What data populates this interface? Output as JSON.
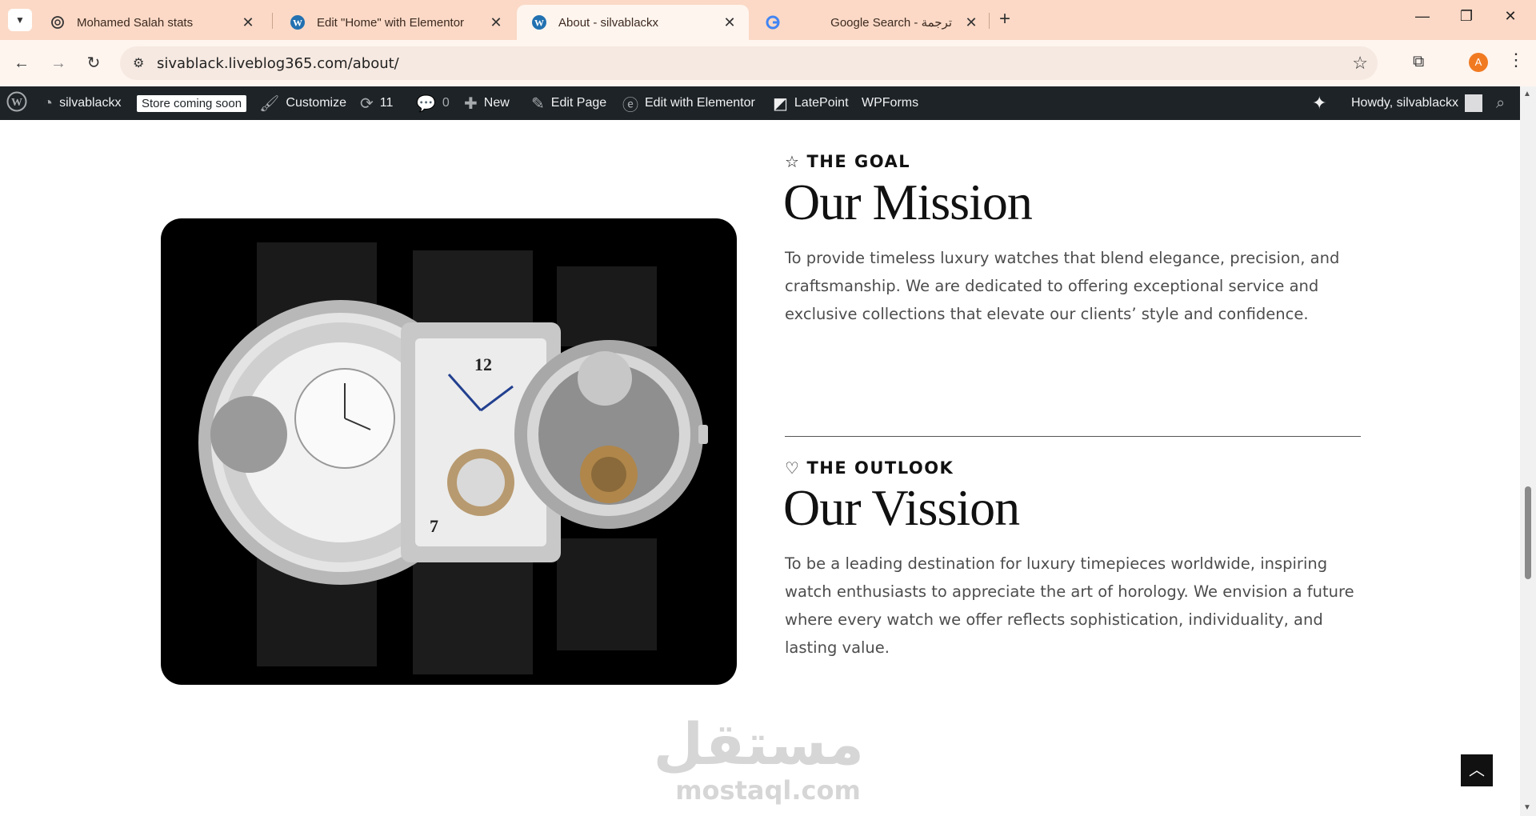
{
  "browser": {
    "tabs": [
      {
        "title": "Mohamed Salah stats",
        "icon": "openai-icon",
        "active": false
      },
      {
        "title": "Edit \"Home\" with Elementor",
        "icon": "wordpress-icon",
        "active": false
      },
      {
        "title": "About - silvablackx",
        "icon": "wordpress-icon",
        "active": true
      },
      {
        "title": "Google Search - ترجمة",
        "icon": "google-icon",
        "active": false
      }
    ],
    "url": "sivablack.liveblog365.com/about/",
    "profile_initial": "A",
    "accent": "#f17a21",
    "tabstrip_color": "#fbd9c6"
  },
  "adminbar": {
    "site_name": "silvablackx",
    "store_badge": "Store coming soon",
    "customize": "Customize",
    "updates_count": "11",
    "comments_count": "0",
    "new_label": "New",
    "edit_page": "Edit Page",
    "edit_elementor": "Edit with Elementor",
    "latepoint": "LatePoint",
    "wpforms": "WPForms",
    "howdy": "Howdy, silvablackx",
    "background": "#1d2327"
  },
  "content": {
    "goal": {
      "eyebrow": "THE GOAL",
      "heading": "Our Mission",
      "text": "To provide timeless luxury watches that blend elegance, precision, and craftsmanship. We are dedicated to offering exceptional service and exclusive collections that elevate our clients’ style and confidence."
    },
    "outlook": {
      "eyebrow": "THE OUTLOOK",
      "heading": "Our Vission",
      "text": "To be a leading destination for luxury timepieces worldwide, inspiring watch enthusiasts to appreciate the art of horology. We envision a future where every watch we offer reflects sophistication, individuality, and lasting value."
    },
    "image": "luxury-watches-photo",
    "watermark_ar": "مستقل",
    "watermark_latin": "mostaql.com"
  }
}
